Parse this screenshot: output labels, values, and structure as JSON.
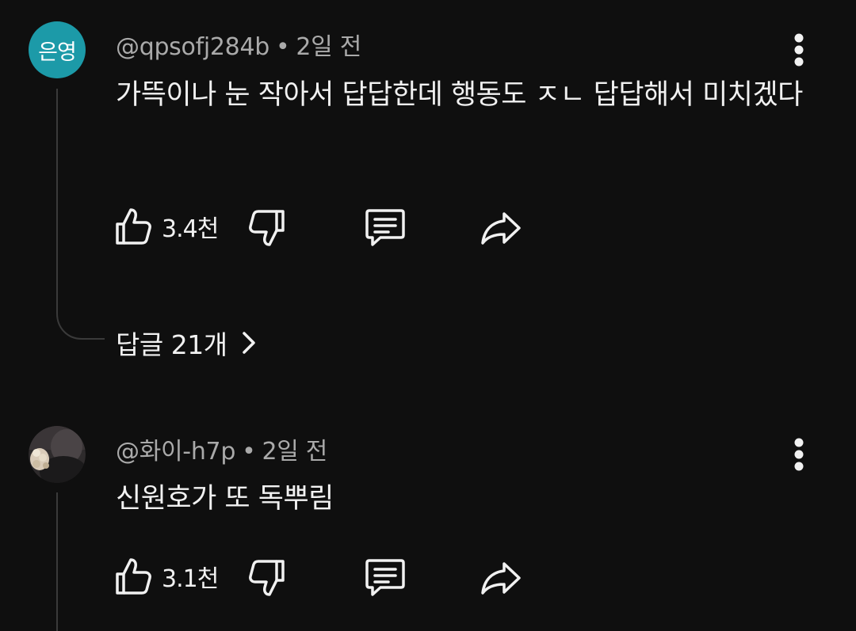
{
  "comments": [
    {
      "avatar_text": "은영",
      "avatar_color": "#1c9aa8",
      "handle": "@qpsofj284b",
      "time": "2일 전",
      "separator": "•",
      "text": "가뜩이나 눈 작아서 답답한데 행동도 ㅈㄴ 답답해서 미치겠다",
      "likes": "3.4천",
      "icons": [
        "thumbs-up-icon",
        "thumbs-down-icon",
        "comment-icon",
        "share-icon",
        "more-vert-icon"
      ],
      "replies_label": "답글 21개"
    },
    {
      "avatar_text": "",
      "handle": "@화이-h7p",
      "time": "2일 전",
      "separator": "•",
      "text": "신원호가 또 독뿌림",
      "likes": "3.1천",
      "icons": [
        "thumbs-up-icon",
        "thumbs-down-icon",
        "comment-icon",
        "share-icon",
        "more-vert-icon"
      ]
    }
  ],
  "colors": {
    "background": "#0f0f0f",
    "text_primary": "#f1f1f1",
    "text_secondary": "#aaaaaa",
    "thread_line": "#3a3a3a"
  }
}
